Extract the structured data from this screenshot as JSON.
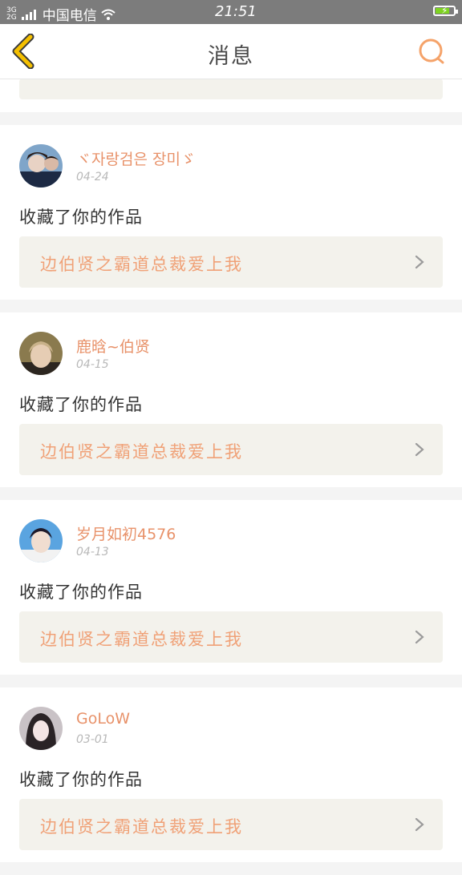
{
  "status_bar": {
    "network_top": "3G",
    "network_bottom": "2G",
    "carrier": "中国电信",
    "time": "21:51"
  },
  "header": {
    "title": "消息",
    "back_icon": "chevron-left-icon",
    "search_icon": "search-icon"
  },
  "colors": {
    "accent_orange": "#f0a177",
    "back_yellow": "#f5c000",
    "search_orange": "#f5a36a",
    "card_bg": "#f3f2ec"
  },
  "messages": [
    {
      "username": "ヾ자랑검은 장미ゞ",
      "date": "04-24",
      "action": "收藏了你的作品",
      "work_title": "边伯贤之霸道总裁爱上我"
    },
    {
      "username": "鹿晗~伯贤",
      "date": "04-15",
      "action": "收藏了你的作品",
      "work_title": "边伯贤之霸道总裁爱上我"
    },
    {
      "username": "岁月如初4576",
      "date": "04-13",
      "action": "收藏了你的作品",
      "work_title": "边伯贤之霸道总裁爱上我"
    },
    {
      "username": "GoLoW",
      "date": "03-01",
      "action": "收藏了你的作品",
      "work_title": "边伯贤之霸道总裁爱上我"
    }
  ]
}
